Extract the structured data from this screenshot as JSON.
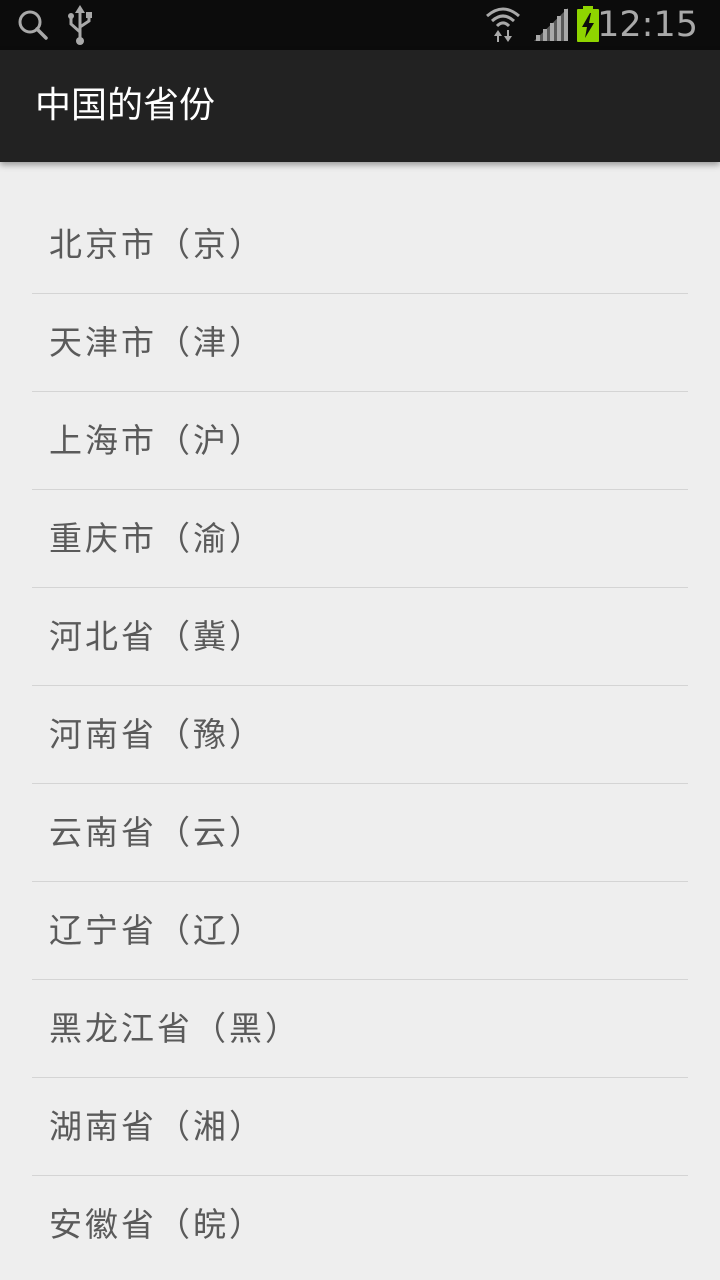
{
  "status_bar": {
    "time": "12:15",
    "icons": [
      "search-icon",
      "usb-icon",
      "wifi-icon",
      "signal-icon",
      "battery-charging-icon"
    ],
    "battery_color": "#8fd400"
  },
  "action_bar": {
    "title": "中国的省份"
  },
  "list": {
    "items": [
      {
        "label": "北京市（京）"
      },
      {
        "label": "天津市（津）"
      },
      {
        "label": "上海市（沪）"
      },
      {
        "label": "重庆市（渝）"
      },
      {
        "label": "河北省（冀）"
      },
      {
        "label": "河南省（豫）"
      },
      {
        "label": "云南省（云）"
      },
      {
        "label": "辽宁省（辽）"
      },
      {
        "label": "黑龙江省（黑）"
      },
      {
        "label": "湖南省（湘）"
      },
      {
        "label": "安徽省（皖）"
      }
    ]
  }
}
